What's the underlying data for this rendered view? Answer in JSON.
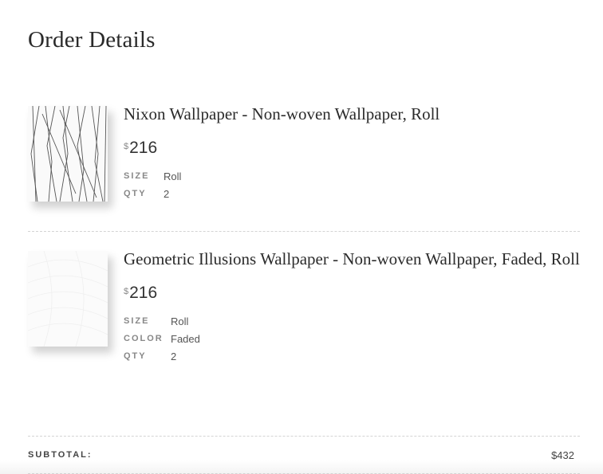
{
  "header": {
    "cut_text": "· · · · · · · · · · · · · · · · · · · · · · · · · · · · · · · ·",
    "title": "Order Details"
  },
  "items": [
    {
      "name": "Nixon Wallpaper - Non-woven Wallpaper, Roll",
      "currency": "$",
      "price": "216",
      "attributes": [
        {
          "key": "SIZE",
          "value": "Roll"
        },
        {
          "key": "QTY",
          "value": "2"
        }
      ],
      "thumbnail": "nixon-wallpaper-swatch"
    },
    {
      "name": "Geometric Illusions Wallpaper - Non-woven Wallpaper, Faded, Roll",
      "currency": "$",
      "price": "216",
      "attributes": [
        {
          "key": "SIZE",
          "value": "Roll"
        },
        {
          "key": "COLOR",
          "value": "Faded"
        },
        {
          "key": "QTY",
          "value": "2"
        }
      ],
      "thumbnail": "geometric-illusions-swatch"
    }
  ],
  "summary": {
    "subtotal_label": "SUBTOTAL:",
    "subtotal_value": "$432"
  }
}
